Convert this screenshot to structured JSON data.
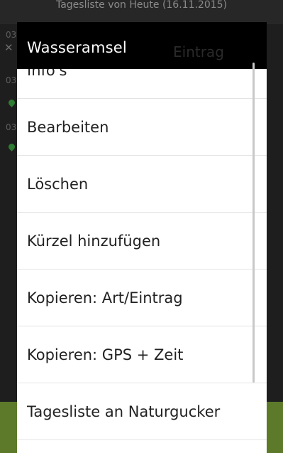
{
  "background": {
    "title": "Tagesliste von Heute (16.11.2015)",
    "row_times": [
      "03",
      "03",
      "03"
    ]
  },
  "dialog": {
    "title": "Wasseramsel",
    "ghost_text": "Eintrag"
  },
  "menu": {
    "items": [
      {
        "label": "Info's"
      },
      {
        "label": "Bearbeiten"
      },
      {
        "label": "Löschen"
      },
      {
        "label": "Kürzel hinzufügen"
      },
      {
        "label": "Kopieren: Art/Eintrag"
      },
      {
        "label": "Kopieren: GPS + Zeit"
      },
      {
        "label": "Tagesliste an Naturgucker"
      }
    ]
  },
  "colors": {
    "dialog_header": "#000000",
    "list_background": "#ffffff",
    "pin_green": "#2e7d32",
    "bottom_yellow": "#d5d300"
  }
}
